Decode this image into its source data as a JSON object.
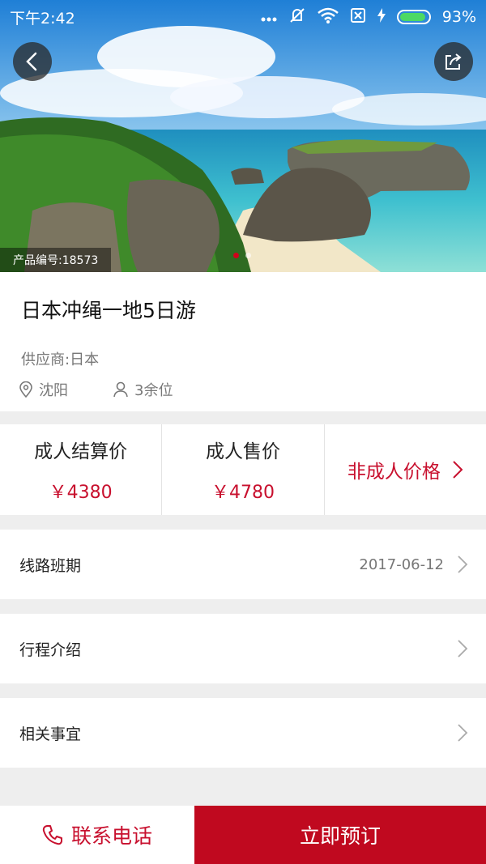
{
  "status_bar": {
    "time": "下午2:42",
    "battery_text": "93%",
    "battery_level": 0.93
  },
  "hero": {
    "product_code": "产品编号:18573",
    "slide_count": 2,
    "active_slide": 1
  },
  "product": {
    "title": "日本冲绳一地5日游",
    "supplier": "供应商:日本",
    "departure_city": "沈阳",
    "seats_left": "3余位"
  },
  "pricing": {
    "adult_settlement_label": "成人结算价",
    "adult_settlement_price": "￥4380",
    "adult_sale_label": "成人售价",
    "adult_sale_price": "￥4780",
    "non_adult_label": "非成人价格"
  },
  "rows": {
    "schedule_label": "线路班期",
    "schedule_date": "2017-06-12",
    "itinerary_label": "行程介绍",
    "notes_label": "相关事宜"
  },
  "bottom_bar": {
    "contact_label": "联系电话",
    "book_label": "立即预订"
  },
  "colors": {
    "accent": "#c8102e",
    "book_button": "#c0091f",
    "background": "#eeeeee"
  }
}
